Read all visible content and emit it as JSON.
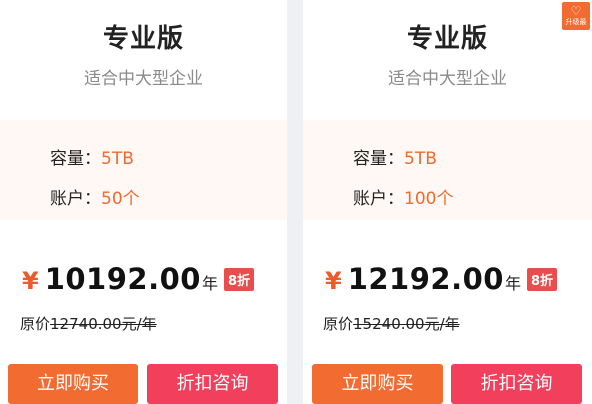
{
  "plans": [
    {
      "title": "专业版",
      "subtitle": "适合中大型企业",
      "capacity_label": "容量：",
      "capacity_value": "5TB",
      "accounts_label": "账户：",
      "accounts_value": "50个",
      "currency": "¥",
      "price": "10192.00",
      "unit": "年",
      "discount": "8折",
      "original_label": "原价",
      "original_price": "12740.00元/年",
      "buy_label": "立即购买",
      "consult_label": "折扣咨询"
    },
    {
      "title": "专业版",
      "subtitle": "适合中大型企业",
      "capacity_label": "容量：",
      "capacity_value": "5TB",
      "accounts_label": "账户：",
      "accounts_value": "100个",
      "currency": "¥",
      "price": "12192.00",
      "unit": "年",
      "discount": "8折",
      "original_label": "原价",
      "original_price": "15240.00元/年",
      "buy_label": "立即购买",
      "consult_label": "折扣咨询",
      "upgrade_badge": "升级最"
    }
  ],
  "colors": {
    "accent": "#f26b30",
    "consult": "#f13f5c",
    "badge": "#ea4d4d",
    "spec_value": "#f06a2d"
  }
}
